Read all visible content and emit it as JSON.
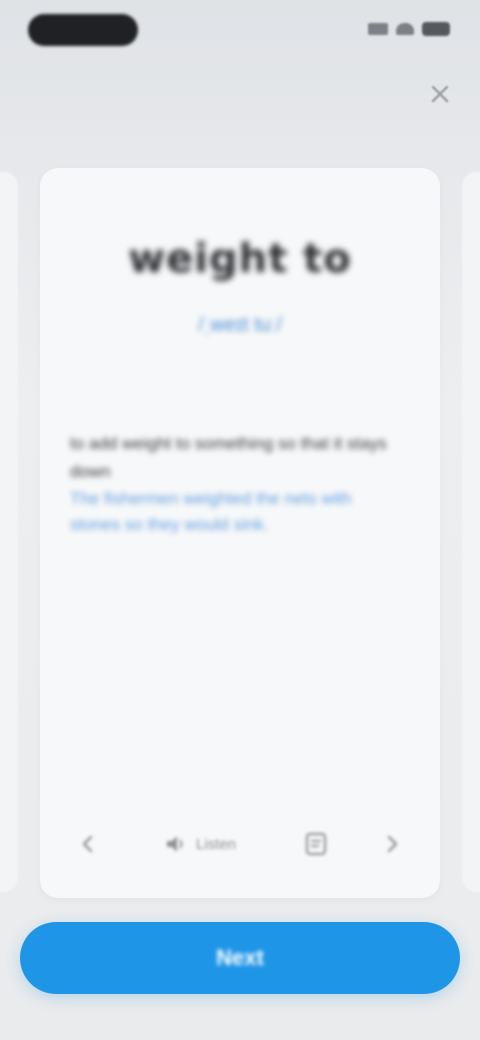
{
  "status_bar": {
    "icons": [
      "signal-icon",
      "wifi-icon",
      "battery-icon"
    ]
  },
  "top_bar": {
    "close_icon": "close-icon"
  },
  "card": {
    "word": "weight to",
    "phonetic": "/ˌweɪt tuː/",
    "definition": "to add weight to something so that it stays down",
    "example": "The fishermen weighted the nets with stones so they would sink.",
    "toolbar": {
      "back_icon": "back-icon",
      "audio_label": "Listen",
      "audio_icon": "speaker-icon",
      "note_icon": "note-icon",
      "next_icon": "next-icon"
    }
  },
  "primary_button": {
    "label": "Next"
  },
  "colors": {
    "accent": "#1f95e8",
    "phonetic": "#4b8fd6",
    "example": "#5f9fe0",
    "card": "#f7f8f9",
    "background": "#e9ebed"
  }
}
